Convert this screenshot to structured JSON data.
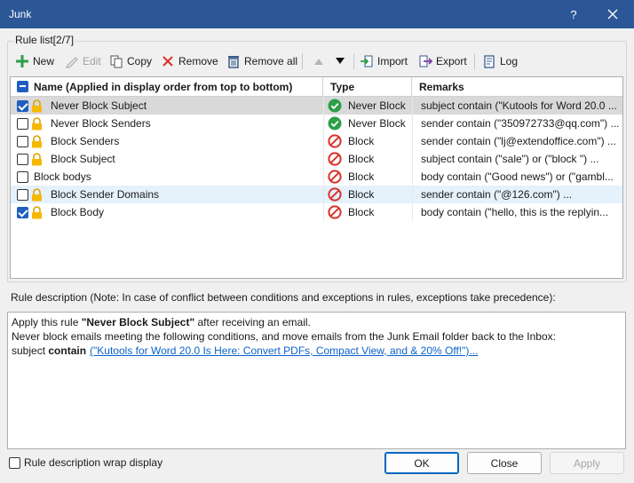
{
  "window": {
    "title": "Junk",
    "help_label": "?"
  },
  "rule_list": {
    "group_title": "Rule list[2/7]",
    "toolbar": {
      "new": "New",
      "edit": "Edit",
      "copy": "Copy",
      "remove": "Remove",
      "remove_all": "Remove all",
      "import": "Import",
      "export": "Export",
      "log": "Log"
    },
    "columns": {
      "name": "Name (Applied in display order from top to bottom)",
      "type": "Type",
      "remarks": "Remarks"
    },
    "rows": [
      {
        "checked": true,
        "locked": true,
        "name": "Never Block Subject",
        "type": "Never Block",
        "type_icon": "check-circle-icon",
        "remarks": "subject contain  (\"Kutools for Word 20.0 ..."
      },
      {
        "checked": false,
        "locked": true,
        "name": "Never Block Senders",
        "type": "Never Block",
        "type_icon": "check-circle-icon",
        "remarks": "sender contain  (\"350972733@qq.com\") ..."
      },
      {
        "checked": false,
        "locked": true,
        "name": "Block Senders",
        "type": "Block",
        "type_icon": "block-icon",
        "remarks": "sender contain  (\"lj@extendoffice.com\") ..."
      },
      {
        "checked": false,
        "locked": true,
        "name": "Block Subject",
        "type": "Block",
        "type_icon": "block-icon",
        "remarks": "subject contain  (\"sale\") or (\"block \") ..."
      },
      {
        "checked": false,
        "locked": false,
        "name": "Block bodys",
        "type": "Block",
        "type_icon": "block-icon",
        "remarks": "body contain  (\"Good news\") or (\"gambl..."
      },
      {
        "checked": false,
        "locked": true,
        "name": "Block Sender Domains",
        "type": "Block",
        "type_icon": "block-icon",
        "remarks": "sender contain  (\"@126.com\") ..."
      },
      {
        "checked": true,
        "locked": true,
        "name": "Block Body",
        "type": "Block",
        "type_icon": "block-icon",
        "remarks": "body contain  (\"hello, this is the replyin..."
      }
    ]
  },
  "description": {
    "label": "Rule description (Note: In case of conflict between conditions and exceptions in rules, exceptions take precedence):",
    "line1_prefix": "Apply this rule ",
    "line1_rule": "\"Never Block Subject\"",
    "line1_suffix": " after receiving an email.",
    "line2": "Never block emails meeting the following conditions, and move emails from the Junk Email folder back to the Inbox:",
    "line3_field": "subject ",
    "line3_op": "contain",
    "line3_link": "(\"Kutools for Word 20.0 Is Here: Convert PDFs, Compact View, and & 20% Off!\")..."
  },
  "footer": {
    "wrap_label": "Rule description wrap display",
    "ok": "OK",
    "close": "Close",
    "apply": "Apply"
  },
  "colors": {
    "titlebar": "#2b5797",
    "accent": "#1f5fbf",
    "never_block": "#2e9e48",
    "block": "#d9322b",
    "link": "#0b62c7"
  }
}
